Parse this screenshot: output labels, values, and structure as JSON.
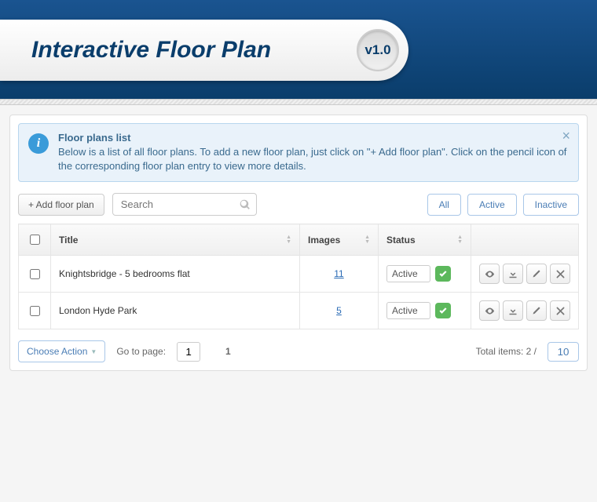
{
  "header": {
    "title": "Interactive Floor Plan",
    "version": "v1.0"
  },
  "alert": {
    "title": "Floor plans list",
    "body": "Below is a list of all floor plans. To add a new floor plan, just click on \"+ Add floor plan\". Click on the pencil icon of the corresponding floor plan entry to view more details."
  },
  "toolbar": {
    "add_label": "+ Add floor plan",
    "search_placeholder": "Search",
    "filters": {
      "all": "All",
      "active": "Active",
      "inactive": "Inactive"
    }
  },
  "table": {
    "columns": {
      "title": "Title",
      "images": "Images",
      "status": "Status"
    },
    "rows": [
      {
        "title": "Knightsbridge - 5 bedrooms flat",
        "images": "11",
        "status": "Active"
      },
      {
        "title": "London Hyde Park",
        "images": "5",
        "status": "Active"
      }
    ]
  },
  "footer": {
    "choose_action": "Choose Action",
    "goto_label": "Go to page:",
    "goto_value": "1",
    "current_page": "1",
    "total_label": "Total items: 2 /",
    "per_page": "10"
  }
}
